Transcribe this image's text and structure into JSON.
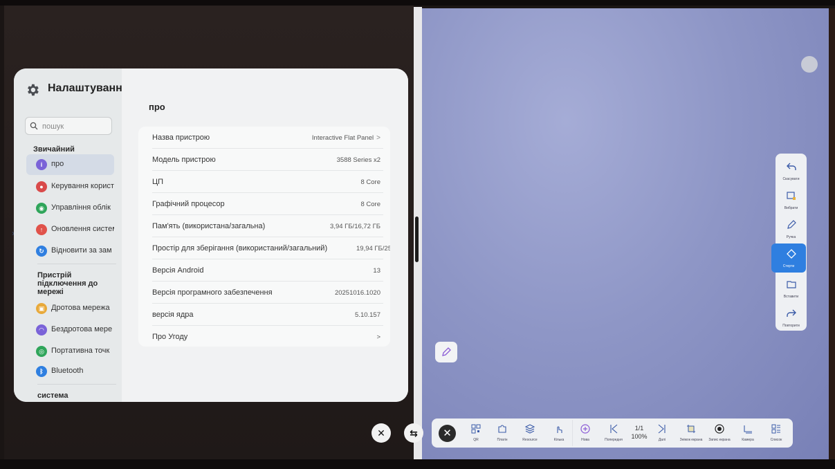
{
  "settings": {
    "title": "Налаштування",
    "search_placeholder": "пошук",
    "groups": {
      "general": "Звичайний",
      "network": "Пристрій підключення до мережі",
      "system": "система"
    },
    "nav": [
      {
        "label": "про",
        "icon": "info-icon",
        "color": "#7a63d8",
        "active": true
      },
      {
        "label": "Керування корист",
        "icon": "users-icon",
        "color": "#d94a4a"
      },
      {
        "label": "Управління облік",
        "icon": "account-icon",
        "color": "#2fa55a"
      },
      {
        "label": "Оновлення систем",
        "icon": "update-icon",
        "color": "#e0524a"
      },
      {
        "label": "Відновити за зам",
        "icon": "restore-icon",
        "color": "#2f7fe0"
      },
      {
        "label": "Дротова мережа",
        "icon": "ethernet-icon",
        "color": "#e8a93a"
      },
      {
        "label": "Бездротова мере",
        "icon": "wifi-icon",
        "color": "#7a63d8"
      },
      {
        "label": "Портативна точк",
        "icon": "hotspot-icon",
        "color": "#2fa55a"
      },
      {
        "label": "Bluetooth",
        "icon": "bluetooth-icon",
        "color": "#2f7fe0"
      }
    ],
    "page_heading": "про",
    "rows": [
      {
        "label": "Назва пристрою",
        "value": "Interactive Flat Panel",
        "chevron": ">"
      },
      {
        "label": "Модель пристрою",
        "value": "3588 Series x2"
      },
      {
        "label": "ЦП",
        "value": "8 Core"
      },
      {
        "label": "Графічний процесор",
        "value": "8 Core"
      },
      {
        "label": "Пам'ять (використана/загальна)",
        "value": "3,94 ГБ/16,72 ГБ"
      },
      {
        "label": "Простір для зберігання (використаний/загальний)",
        "value": "19,94 ГБ/25"
      },
      {
        "label": "Версія Android",
        "value": "13"
      },
      {
        "label": "Версія програмного забезпечення",
        "value": "20251016.1020"
      },
      {
        "label": "версія ядра",
        "value": "5.10.157"
      },
      {
        "label": "Про Угоду",
        "value": "",
        "chevron": ">"
      }
    ]
  },
  "side_toolbar": [
    {
      "label": "Скасувати",
      "icon": "undo-icon"
    },
    {
      "label": "Вибрати",
      "icon": "select-icon"
    },
    {
      "label": "Ручка",
      "icon": "pen-icon"
    },
    {
      "label": "Стерти",
      "icon": "eraser-icon",
      "active": true
    },
    {
      "label": "Вставити",
      "icon": "insert-icon"
    },
    {
      "label": "Повторити",
      "icon": "redo-icon"
    }
  ],
  "bottom_bar": {
    "close": "✕",
    "items": [
      {
        "label": "QR",
        "icon": "qr-icon"
      },
      {
        "label": "Плагін",
        "icon": "plugin-icon"
      },
      {
        "label": "Resource",
        "icon": "resource-icon"
      },
      {
        "label": "Кілька",
        "icon": "multi-touch-icon"
      },
      {
        "label": "Нова",
        "icon": "new-page-icon"
      },
      {
        "label": "Попередня",
        "icon": "prev-page-icon"
      },
      {
        "label": "Далі",
        "icon": "next-page-icon"
      },
      {
        "label": "Знімок екрана",
        "icon": "screenshot-icon"
      },
      {
        "label": "Запис екрана",
        "icon": "record-icon"
      },
      {
        "label": "Камера",
        "icon": "camera-icon"
      },
      {
        "label": "Список",
        "icon": "list-icon"
      }
    ],
    "page": "1/1",
    "zoom": "100%"
  },
  "controls": {
    "close_split": "✕",
    "swap_split": "⇆"
  },
  "colors": {
    "accent": "#2f7fe0",
    "whiteboard": "#8e96c6"
  }
}
